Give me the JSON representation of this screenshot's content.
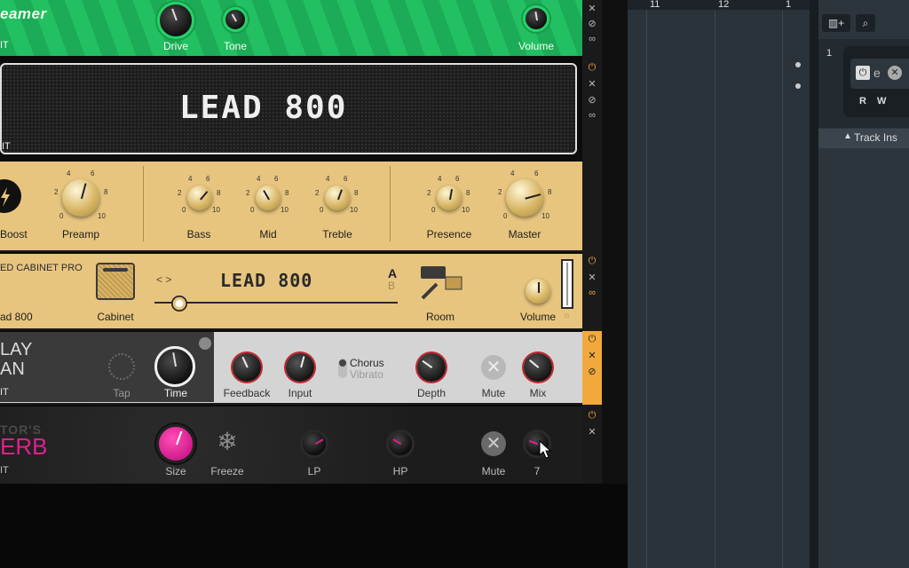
{
  "screamer": {
    "logo": "eamer",
    "bypass": "IT",
    "knobs": {
      "drive": "Drive",
      "tone": "Tone",
      "volume": "Volume"
    }
  },
  "amp": {
    "name": "LEAD 800",
    "bypass": "IT",
    "controls": {
      "boost": "Boost",
      "preamp": "Preamp",
      "bass": "Bass",
      "mid": "Mid",
      "treble": "Treble",
      "presence": "Presence",
      "master": "Master"
    },
    "ticks": {
      "t0": "0",
      "t2": "2",
      "t4": "4",
      "t6": "6",
      "t8": "8",
      "t10": "10"
    }
  },
  "cabinet": {
    "title": "ED CABINET PRO",
    "preset": "ad 800",
    "cab_label": "Cabinet",
    "name": "LEAD 800",
    "ab_a": "A",
    "ab_b": "B",
    "arrows": "< >",
    "room": "Room",
    "volume": "Volume"
  },
  "delay": {
    "title_line1": "LAY",
    "title_line2": "AN",
    "bypass": "IT",
    "tap": "Tap",
    "time": "Time",
    "feedback": "Feedback",
    "input": "Input",
    "chorus": "Chorus",
    "vibrato": "Vibrato",
    "depth": "Depth",
    "mute": "Mute",
    "mix": "Mix"
  },
  "reverb": {
    "title_line1": "TOR'S",
    "title_line2": "ERB",
    "bypass": "IT",
    "size": "Size",
    "freeze": "Freeze",
    "lp": "LP",
    "hp": "HP",
    "mute": "Mute",
    "mix": "7"
  },
  "daw": {
    "ruler": {
      "m11": "11",
      "m12": "12",
      "m13": "1"
    },
    "track_number": "1",
    "track_inspector": "Track Ins",
    "buttons": {
      "r": "R",
      "w": "W"
    }
  },
  "colors": {
    "screamer_green": "#1cab56",
    "amp_gold": "#e8c57e",
    "delay_gray": "#d4d4d4",
    "reverb_pink": "#e0208f",
    "knob_red": "#c0262e",
    "power_yellow": "#f2a93b"
  }
}
